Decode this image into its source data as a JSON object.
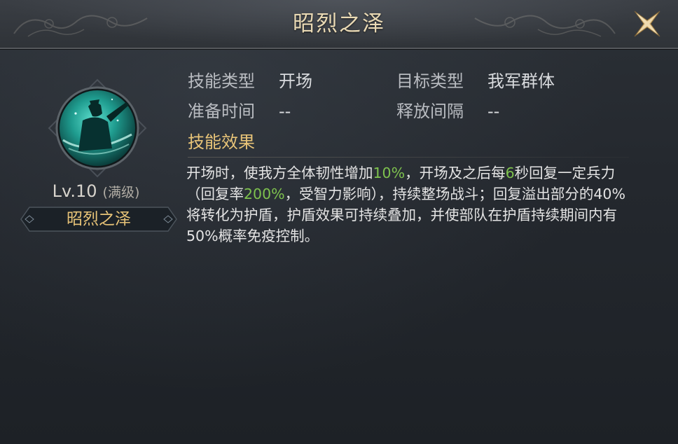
{
  "dialog": {
    "title": "昭烈之泽",
    "close_icon": "close-x-icon"
  },
  "skill": {
    "icon": "warrior-portrait-icon",
    "level": "Lv.10",
    "level_note": "(满级)",
    "name": "昭烈之泽"
  },
  "info": {
    "skill_type_label": "技能类型",
    "skill_type_value": "开场",
    "target_type_label": "目标类型",
    "target_type_value": "我军群体",
    "prep_time_label": "准备时间",
    "prep_time_value": "--",
    "interval_label": "释放间隔",
    "interval_value": "--"
  },
  "effect": {
    "title": "技能效果",
    "seg1": "开场时，使我方全体韧性增加",
    "hl1": "10%",
    "seg2": "，开场及之后每",
    "hl2": "6",
    "seg3": "秒回复一定兵力（回复率",
    "hl3": "200%",
    "seg4": "，受智力影响），持续整场战斗；回复溢出部分的40%将转化为护盾，护盾效果可持续叠加，并使部队在护盾持续期间内有50%概率免疫控制。"
  },
  "colors": {
    "title_gold": "#e9d9b4",
    "accent_gold": "#e8c478",
    "highlight_green": "#7ec24e",
    "icon_teal": "#2fb7a8"
  }
}
